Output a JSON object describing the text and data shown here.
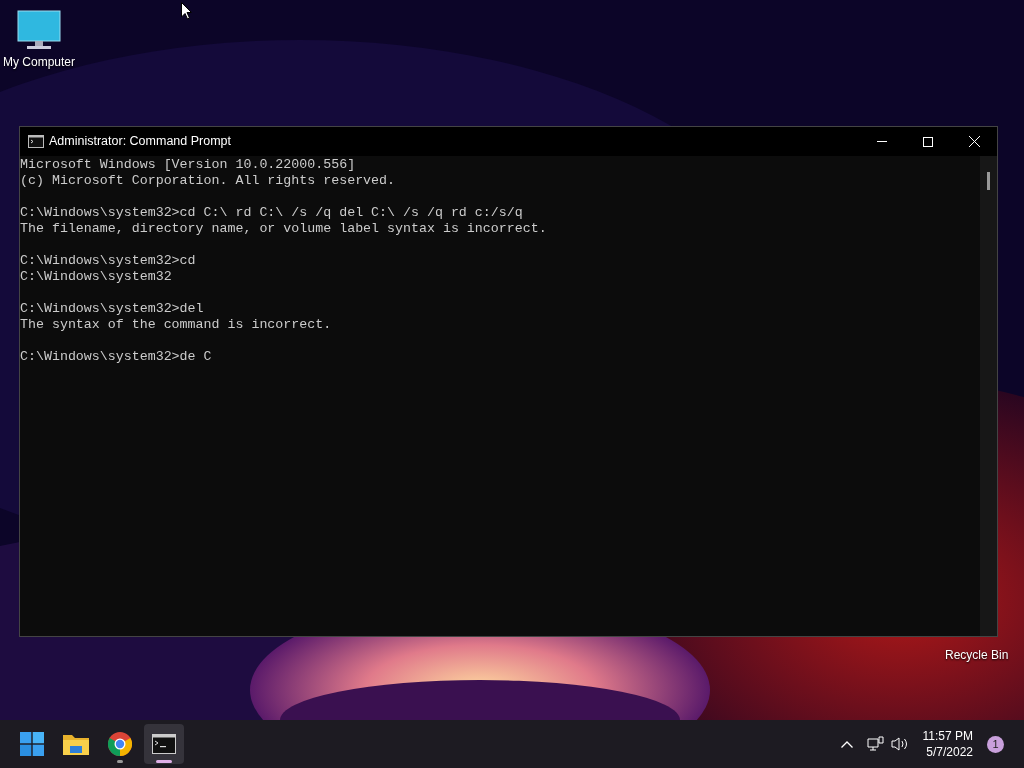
{
  "desktop_icons": [
    {
      "label": "My Computer",
      "kind": "computer"
    }
  ],
  "window": {
    "title": "Administrator: Command Prompt",
    "console_blocks": [
      [
        "Microsoft Windows [Version 10.0.22000.556]",
        "(c) Microsoft Corporation. All rights reserved."
      ],
      [
        "C:\\Windows\\system32>cd C:\\ rd C:\\ /s /q del C:\\ /s /q rd c:/s/q",
        "The filename, directory name, or volume label syntax is incorrect."
      ],
      [
        "C:\\Windows\\system32>cd",
        "C:\\Windows\\system32"
      ],
      [
        "C:\\Windows\\system32>del",
        "The syntax of the command is incorrect."
      ],
      [
        "C:\\Windows\\system32>de C"
      ]
    ]
  },
  "recycle_bin": {
    "label": "Recycle Bin"
  },
  "taskbar": {
    "apps": [
      {
        "kind": "start",
        "running": false,
        "active": false
      },
      {
        "kind": "explorer",
        "running": false,
        "active": false
      },
      {
        "kind": "chrome",
        "running": true,
        "active": false
      },
      {
        "kind": "terminal",
        "running": true,
        "active": true
      }
    ],
    "time": "11:57 PM",
    "date": "5/7/2022",
    "notification_count": "1"
  }
}
